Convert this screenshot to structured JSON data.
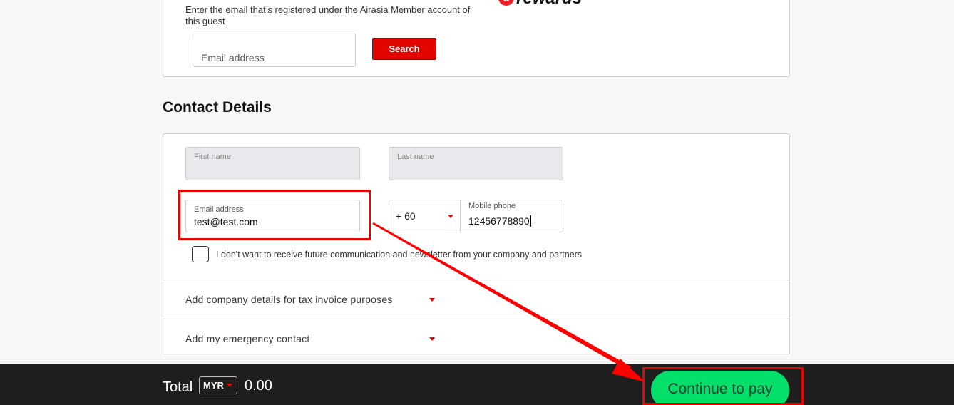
{
  "member_lookup": {
    "hint": "Enter the email that’s registered under the Airasia Member account of this guest",
    "logo_mark": "a",
    "logo_word": "rewards",
    "email_placeholder": "Email address",
    "search_label": "Search"
  },
  "contact": {
    "title": "Contact Details",
    "first_name": {
      "label": "First name",
      "value": ""
    },
    "last_name": {
      "label": "Last name",
      "value": ""
    },
    "email": {
      "label": "Email address",
      "value": "test@test.com"
    },
    "country_code": {
      "value": "+ 60"
    },
    "mobile": {
      "label": "Mobile phone",
      "value": "12456778890"
    },
    "optin_label": "I don't want to receive future communication and newsletter from your company and partners",
    "optin_checked": false,
    "accordions": [
      {
        "label": "Add company details for tax invoice purposes"
      },
      {
        "label": "Add my emergency contact"
      }
    ]
  },
  "footer": {
    "total_label": "Total",
    "currency": "MYR",
    "amount": "0.00",
    "pay_label": "Continue to pay"
  },
  "annotations": {
    "highlight_color": "#e10600",
    "highlights": [
      "email-field",
      "continue-to-pay-button"
    ],
    "arrow": "from email field to continue-to-pay button"
  },
  "colors": {
    "brand_red": "#e10600",
    "pay_green": "#02e06a",
    "footer_bg": "#1e1e1e"
  }
}
